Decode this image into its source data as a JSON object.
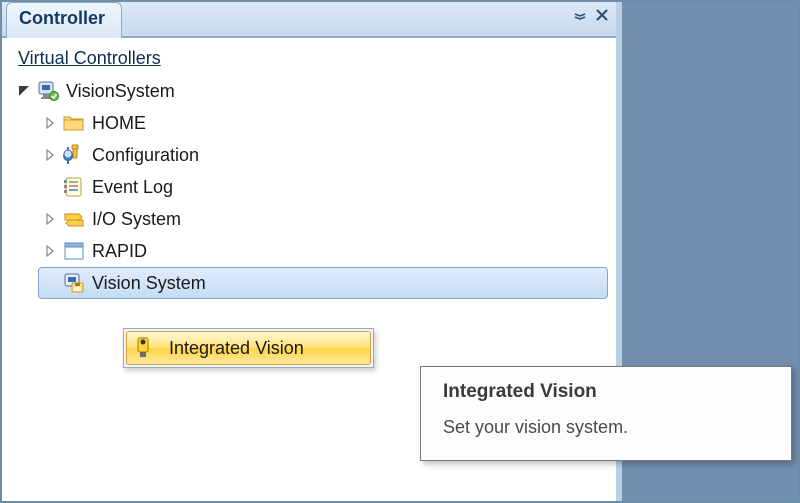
{
  "panel": {
    "tab_title": "Controller",
    "section_title": "Virtual Controllers"
  },
  "tree": {
    "root_label": "VisionSystem",
    "items": [
      {
        "label": "HOME"
      },
      {
        "label": "Configuration"
      },
      {
        "label": "Event Log"
      },
      {
        "label": "I/O System"
      },
      {
        "label": "RAPID"
      },
      {
        "label": "Vision System"
      }
    ]
  },
  "context_menu": {
    "item_label": "Integrated Vision"
  },
  "tooltip": {
    "title": "Integrated Vision",
    "body": "Set your vision system."
  }
}
